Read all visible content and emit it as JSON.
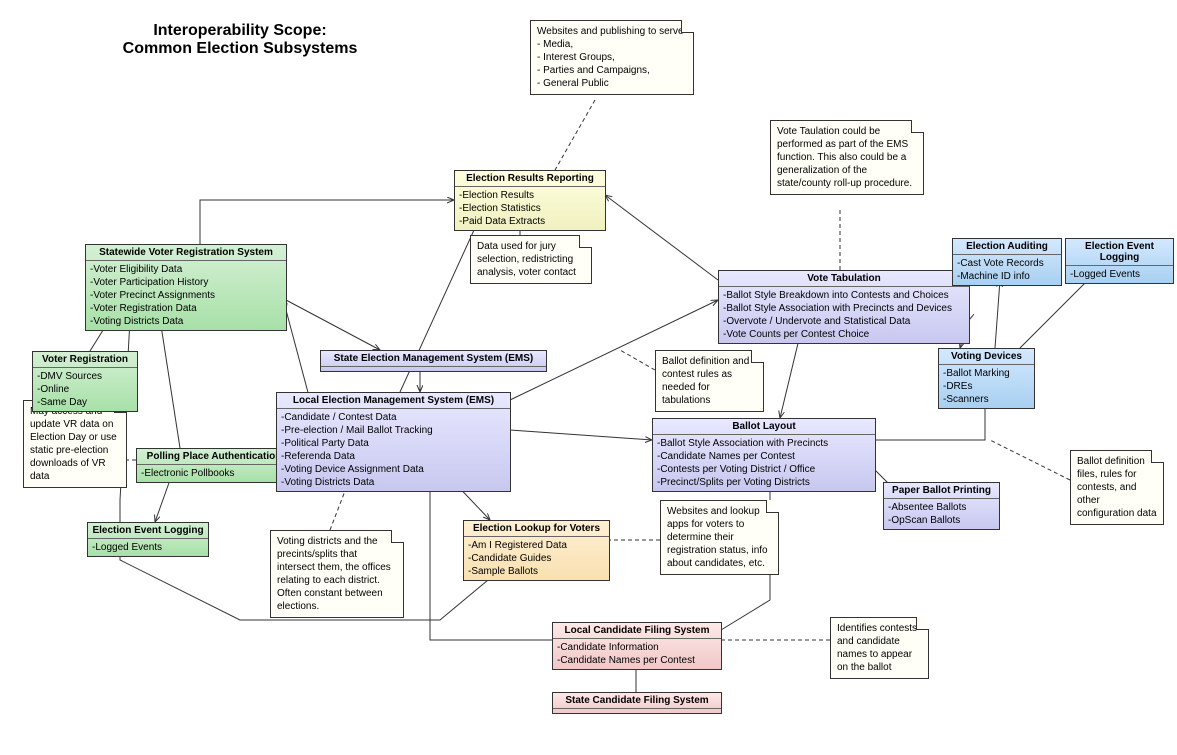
{
  "title": {
    "line1": "Interoperability Scope:",
    "line2": "Common Election Subsystems"
  },
  "boxes": {
    "svrs": {
      "hdr": "Statewide Voter Registration System",
      "items": [
        "-Voter Eligibility Data",
        "-Voter Participation History",
        "-Voter Precinct Assignments",
        "-Voter Registration Data",
        "-Voting Districts Data"
      ]
    },
    "vr": {
      "hdr": "Voter Registration",
      "items": [
        "-DMV Sources",
        "-Online",
        "-Same Day"
      ]
    },
    "ppa": {
      "hdr": "Polling Place Authentication",
      "items": [
        "-Electronic Pollbooks"
      ]
    },
    "eel1": {
      "hdr": "Election Event Logging",
      "items": [
        "-Logged Events"
      ]
    },
    "sems": {
      "hdr": "State Election Management System (EMS)",
      "items": []
    },
    "lems": {
      "hdr": "Local Election Management System (EMS)",
      "items": [
        "-Candidate / Contest Data",
        "-Pre-election / Mail Ballot Tracking",
        "-Political Party Data",
        "-Referenda Data",
        "-Voting Device Assignment Data",
        "-Voting Districts Data"
      ]
    },
    "err": {
      "hdr": "Election Results Reporting",
      "items": [
        "-Election Results",
        "-Election Statistics",
        "-Paid Data Extracts"
      ]
    },
    "elv": {
      "hdr": "Election Lookup for Voters",
      "items": [
        "-Am I Registered Data",
        "-Candidate Guides",
        "-Sample Ballots"
      ]
    },
    "lcfs": {
      "hdr": "Local Candidate Filing System",
      "items": [
        "-Candidate Information",
        "-Candidate Names per Contest"
      ]
    },
    "scfs": {
      "hdr": "State Candidate Filing System",
      "items": []
    },
    "vt": {
      "hdr": "Vote Tabulation",
      "items": [
        "-Ballot Style Breakdown into Contests and Choices",
        "-Ballot Style Association with Precincts and Devices",
        "-Overvote / Undervote and Statistical Data",
        "-Vote Counts per Contest Choice"
      ]
    },
    "bl": {
      "hdr": "Ballot Layout",
      "items": [
        "-Ballot Style Association with Precincts",
        "-Candidate Names per Contest",
        "-Contests per Voting District / Office",
        "-Precinct/Splits per Voting Districts"
      ]
    },
    "pbp": {
      "hdr": "Paper Ballot Printing",
      "items": [
        "-Absentee Ballots",
        "-OpScan Ballots"
      ]
    },
    "ea": {
      "hdr": "Election Auditing",
      "items": [
        "-Cast Vote Records",
        "-Machine ID info"
      ]
    },
    "vd": {
      "hdr": "Voting Devices",
      "items": [
        "-Ballot Marking",
        "-DREs",
        "-Scanners"
      ]
    },
    "eel2": {
      "hdr": "Election Event Logging",
      "items": [
        "-Logged Events"
      ]
    }
  },
  "notes": {
    "n1": "Websites and publishing to serve\n- Media,\n- Interest Groups,\n- Parties and Campaigns,\n- General Public",
    "n2": "Data used for jury selection, redistricting analysis, voter contact",
    "n3": "May access and update VR data on Election Day or use static pre-election downloads of VR data",
    "n4": "Voting districts and the precints/splits that intersect them, the offices relating to each district. Often constant between elections.",
    "n5": "Ballot definition and contest rules as needed for tabulations",
    "n6": "Websites and lookup apps for voters to determine their registration status, info about candidates, etc.",
    "n7": "Vote Taulation could be performed as part of the EMS function.  This also could be a generalization of the state/county roll-up procedure.",
    "n8": "Identifies contests and candidate names to appear on the ballot",
    "n9": "Ballot definition files, rules for contests, and other configuration data"
  }
}
